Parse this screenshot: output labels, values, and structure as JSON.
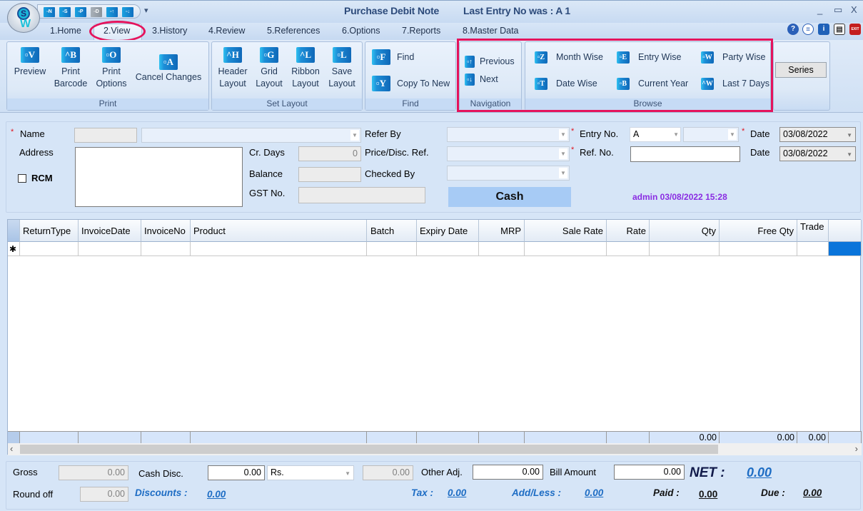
{
  "window": {
    "title": "Purchase Debit Note",
    "last_entry": "Last Entry No was : A 1",
    "minimize": "_",
    "maximize": "▭",
    "close": "X"
  },
  "quick_access": [
    {
      "name": "new-icon",
      "glyph": "▫N"
    },
    {
      "name": "save-icon",
      "glyph": "▫S"
    },
    {
      "name": "print-icon",
      "glyph": "▫P"
    },
    {
      "name": "delete-icon",
      "glyph": "▫D"
    },
    {
      "name": "previous-icon",
      "glyph": "▫↑"
    },
    {
      "name": "next-icon",
      "glyph": "▫↓"
    }
  ],
  "qat_menu": "₹",
  "logo": {
    "letter": "S",
    "mark": "W"
  },
  "tabs": [
    {
      "label": "1.Home"
    },
    {
      "label": "2.View",
      "active": true
    },
    {
      "label": "3.History"
    },
    {
      "label": "4.Review"
    },
    {
      "label": "5.References"
    },
    {
      "label": "6.Options"
    },
    {
      "label": "7.Reports"
    },
    {
      "label": "8.Master Data"
    }
  ],
  "help_icons": [
    {
      "name": "help-icon",
      "glyph": "?"
    },
    {
      "name": "chat-icon",
      "glyph": "≡"
    },
    {
      "name": "info-icon",
      "glyph": "i"
    },
    {
      "name": "document-icon",
      "glyph": "▤"
    },
    {
      "name": "exit-icon",
      "glyph": "EXIT"
    }
  ],
  "ribbon": {
    "print": {
      "label": "Print",
      "buttons": [
        {
          "line1": "Preview",
          "line2": "",
          "icon": "▫V"
        },
        {
          "line1": "Print",
          "line2": "Barcode",
          "icon": "^B"
        },
        {
          "line1": "Print",
          "line2": "Options",
          "icon": "▫O"
        },
        {
          "line1": "Cancel Changes",
          "line2": "",
          "icon": "▫A"
        }
      ]
    },
    "set_layout": {
      "label": "Set Layout",
      "buttons": [
        {
          "line1": "Header",
          "line2": "Layout",
          "icon": "^H"
        },
        {
          "line1": "Grid",
          "line2": "Layout",
          "icon": "▫G"
        },
        {
          "line1": "Ribbon",
          "line2": "Layout",
          "icon": "^L"
        },
        {
          "line1": "Save",
          "line2": "Layout",
          "icon": "▫L"
        }
      ]
    },
    "find": {
      "label": "Find",
      "buttons": [
        {
          "label": "Find",
          "icon": "▫F"
        },
        {
          "label": "Copy To New",
          "icon": "▫Y"
        }
      ]
    },
    "navigation": {
      "label": "Navigation",
      "buttons": [
        {
          "label": "Previous",
          "icon": "▫↑"
        },
        {
          "label": "Next",
          "icon": "▫↓"
        }
      ]
    },
    "browse": {
      "label": "Browse",
      "buttons": [
        {
          "label": "Month Wise",
          "icon": "▫Z"
        },
        {
          "label": "Entry Wise",
          "icon": "▫E"
        },
        {
          "label": "Party Wise",
          "icon": "▫W"
        },
        {
          "label": "Date Wise",
          "icon": "▫T"
        },
        {
          "label": "Current Year",
          "icon": "▫B"
        },
        {
          "label": "Last 7 Days",
          "icon": "^W"
        }
      ]
    },
    "series_label": "Series"
  },
  "form": {
    "name_label": "Name",
    "name_code": "",
    "name_value": "",
    "address_label": "Address",
    "address_value": "",
    "rcm_label": "RCM",
    "rcm_checked": false,
    "cr_days_label": "Cr. Days",
    "cr_days_value": "0",
    "balance_label": "Balance",
    "balance_value": "",
    "gst_label": "GST No.",
    "gst_value": "",
    "refer_by_label": "Refer By",
    "refer_by_value": "",
    "price_ref_label": "Price/Disc. Ref.",
    "price_ref_value": "",
    "checked_by_label": "Checked By",
    "checked_by_value": "",
    "cash_label": "Cash",
    "entry_no_label": "Entry No.",
    "entry_series": "A",
    "entry_number": "",
    "ref_no_label": "Ref. No.",
    "ref_no_value": "",
    "date_label": "Date",
    "date_value": "03/08/2022",
    "date2_label": "Date",
    "date2_value": "03/08/2022",
    "audit": "admin 03/08/2022 15:28",
    "required_mark": "*"
  },
  "grid": {
    "columns": [
      "ReturnType",
      "InvoiceDate",
      "InvoiceNo",
      "Product",
      "Batch",
      "Expiry Date",
      "MRP",
      "Sale Rate",
      "Rate",
      "Qty",
      "Free Qty",
      "Trade"
    ],
    "new_row_marker": "✱",
    "totals": {
      "qty": "0.00",
      "free_qty": "0.00",
      "trade": "0.00"
    },
    "scroll_left": "‹",
    "scroll_right": "›"
  },
  "footer": {
    "gross_label": "Gross",
    "gross_value": "0.00",
    "cash_disc_label": "Cash Disc.",
    "cash_disc_value": "0.00",
    "cash_disc_unit": "Rs.",
    "cash_disc_amount": "0.00",
    "other_adj_label": "Other Adj.",
    "other_adj_value": "0.00",
    "bill_amount_label": "Bill Amount",
    "bill_amount_value": "0.00",
    "net_label": "NET :",
    "net_value": "0.00",
    "round_off_label": "Round off",
    "round_off_value": "0.00",
    "discounts_label": "Discounts :",
    "discounts_value": "0.00",
    "tax_label": "Tax :",
    "tax_value": "0.00",
    "add_less_label": "Add/Less :",
    "add_less_value": "0.00",
    "paid_label": "Paid :",
    "paid_value": "0.00",
    "due_label": "Due :",
    "due_value": "0.00"
  },
  "colors": {
    "highlight": "#e5135c",
    "accent": "#1e6dc4",
    "audit": "#8a2be2",
    "cash_button": "#a7cbf5",
    "selected_cell": "#0a74da"
  }
}
